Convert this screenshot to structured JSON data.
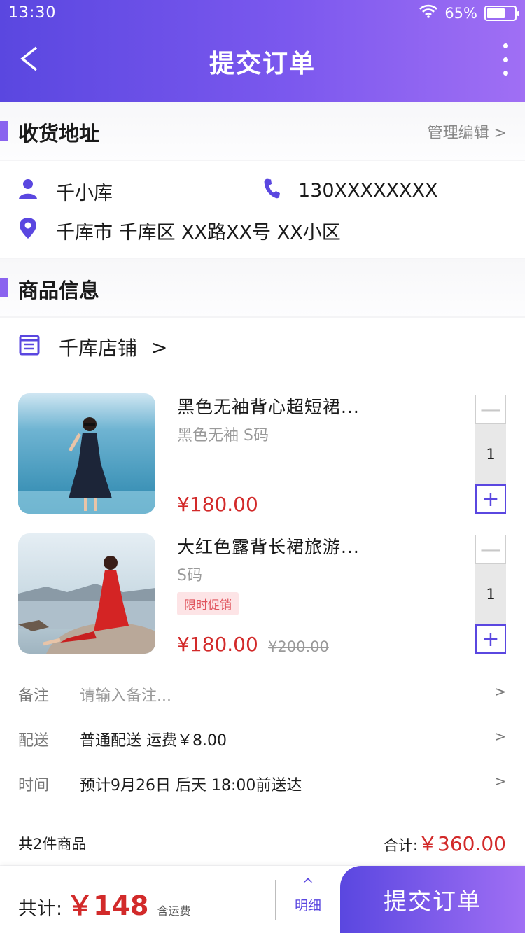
{
  "status": {
    "time": "13:30",
    "battery": "65%",
    "battery_level": 0.65
  },
  "header": {
    "title": "提交订单"
  },
  "address_section": {
    "title": "收货地址",
    "manage_link": "管理编辑 >"
  },
  "address": {
    "name": "千小库",
    "phone": "130XXXXXXXX",
    "location": "千库市 千库区 XX路XX号 XX小区"
  },
  "product_section": {
    "title": "商品信息"
  },
  "shop": {
    "name": "千库店铺",
    "arrow": ">"
  },
  "items": [
    {
      "name": "黑色无袖背心超短裙...",
      "spec": "黑色无袖 S码",
      "tag": "",
      "price": "¥180.00",
      "original_price": "",
      "qty": "1"
    },
    {
      "name": "大红色露背长裙旅游...",
      "spec": "S码",
      "tag": "限时促销",
      "price": "¥180.00",
      "original_price": "¥200.00",
      "qty": "1"
    }
  ],
  "options": {
    "remark": {
      "label": "备注",
      "placeholder": "请输入备注..."
    },
    "delivery": {
      "label": "配送",
      "value": "普通配送 运费￥8.00"
    },
    "time": {
      "label": "时间",
      "value": "预计9月26日 后天 18:00前送达"
    },
    "chevron": ">"
  },
  "summary": {
    "count": "共2件商品",
    "total_label": "合计:",
    "total_value": "￥360.00"
  },
  "footer": {
    "total_label": "共计:",
    "total_amount": "￥148",
    "fee_note": "含运费",
    "detail_caret": "^",
    "detail_label": "明细",
    "submit_label": "提交订单"
  },
  "colors": {
    "accent": "#5a47e0",
    "accent_light": "#a06ff4",
    "price": "#d22a2a",
    "promo_bg": "#fde4e6"
  }
}
